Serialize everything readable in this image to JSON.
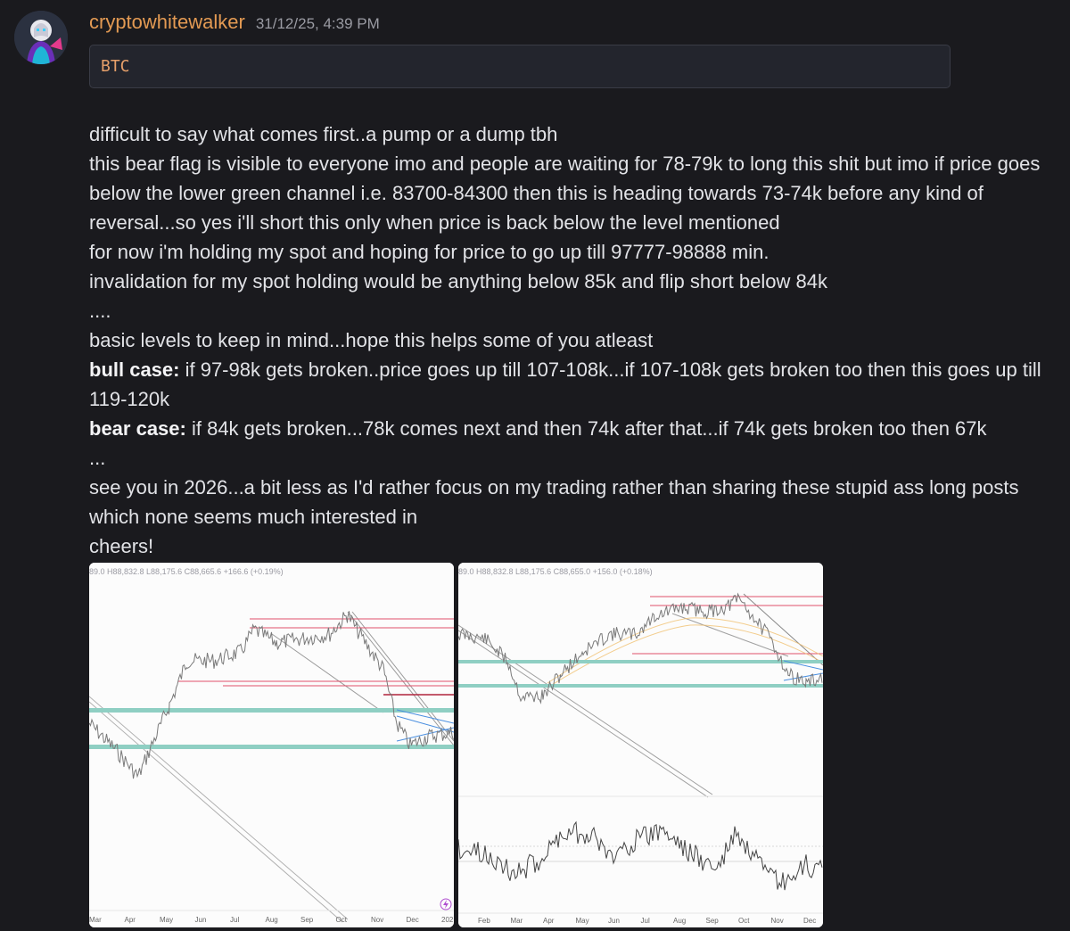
{
  "user": {
    "name": "cryptowhitewalker",
    "timestamp": "31/12/25, 4:39 PM"
  },
  "code_block": "BTC",
  "message": {
    "line1": "difficult to say what comes first..a pump or a dump tbh",
    "line2": "this bear flag is visible to everyone imo and people are waiting for 78-79k to long this shit but imo if price goes below the lower green channel i.e. 83700-84300 then this is heading towards 73-74k before any kind of reversal...so yes i'll short this only when price is back below the level mentioned",
    "line3": "for now i'm holding my spot and hoping for price to go up till 97777-98888 min.",
    "line4": "invalidation for my spot holding would be anything below 85k and flip short below 84k",
    "line5": "....",
    "line6": "basic levels to keep in mind...hope this helps some of you atleast",
    "bull_label": "bull case:",
    "bull_text": " if 97-98k gets broken..price goes up till 107-108k...if 107-108k gets broken too then this goes up till 119-120k",
    "bear_label": "bear case:",
    "bear_text": " if 84k gets broken...78k comes next and then 74k after that...if 74k gets broken too then 67k",
    "line9": "...",
    "line10": "see you in 2026...a bit less as I'd rather focus on my trading rather than sharing these stupid ass long posts which none seems much interested in",
    "line11": "cheers!"
  },
  "attachments": [
    {
      "ohlc_text": "89.0 H88,832.8 L88,175.6 C88,665.6 +166.6 (+0.19%)",
      "x_labels": [
        "Mar",
        "Apr",
        "May",
        "Jun",
        "Jul",
        "Aug",
        "Sep",
        "Oct",
        "Nov",
        "Dec",
        "202"
      ]
    },
    {
      "ohlc_text": "89.0 H88,832.8 L88,175.6 C88,655.0 +156.0 (+0.18%)",
      "x_labels": [
        "Feb",
        "Mar",
        "Apr",
        "May",
        "Jun",
        "Jul",
        "Aug",
        "Sep",
        "Oct",
        "Nov",
        "Dec"
      ]
    }
  ],
  "colors": {
    "username": "#e39a53",
    "green_channel": "#8fcfc3",
    "red_level": "#e0506a",
    "background": "#1a1a1e"
  }
}
